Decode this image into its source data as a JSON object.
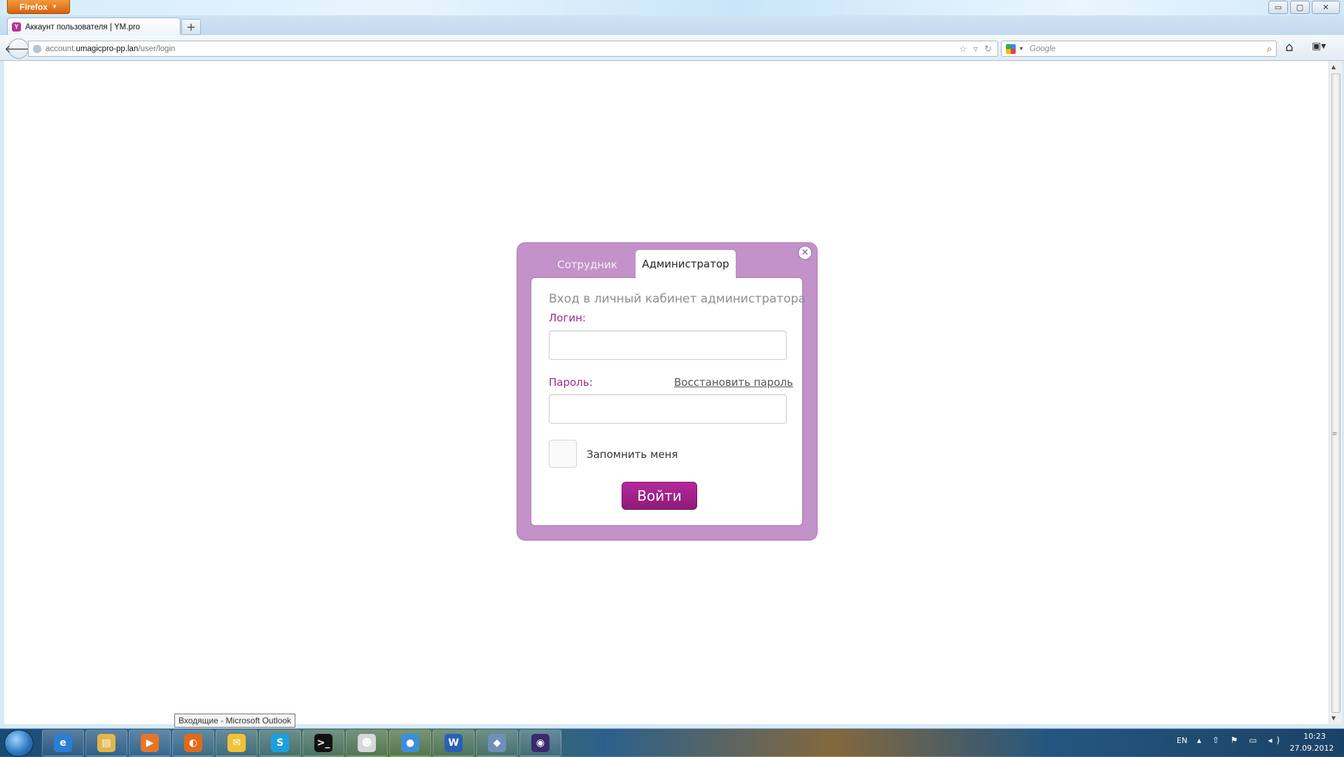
{
  "window": {
    "app_menu": "Firefox",
    "controls": {
      "minimize": "▭",
      "maximize": "▢",
      "close": "✕"
    }
  },
  "browser": {
    "tab_title": "Аккаунт пользователя | YM.pro",
    "new_tab": "+",
    "url_prefix": "account.",
    "url_domain": "umagicpro-pp.lan",
    "url_path": "/user/login",
    "search_placeholder": "Google"
  },
  "dialog": {
    "close_symbol": "×",
    "tabs": {
      "employee": "Сотрудник",
      "admin": "Администратор"
    },
    "heading": "Вход в личный кабинет администратора",
    "login_label": "Логин:",
    "login_value": "",
    "password_label": "Пароль:",
    "password_value": "",
    "restore_link": "Восстановить пароль",
    "remember_label": "Запомнить меня",
    "remember_checked": false,
    "submit": "Войти",
    "colors": {
      "frame": "#c292c8",
      "accent": "#9c2a8c",
      "button": "#a3228b"
    }
  },
  "taskbar": {
    "tooltip": "Входящие - Microsoft Outlook",
    "items": [
      {
        "name": "internet-explorer-icon",
        "glyph": "e",
        "color": "#2a7fd4"
      },
      {
        "name": "explorer-folder-icon",
        "glyph": "▤",
        "color": "#e3b54a"
      },
      {
        "name": "media-player-icon",
        "glyph": "▶",
        "color": "#e3762a"
      },
      {
        "name": "firefox-icon",
        "glyph": "◐",
        "color": "#e06a1c"
      },
      {
        "name": "outlook-icon",
        "glyph": "✉",
        "color": "#f0c23a"
      },
      {
        "name": "skype-icon",
        "glyph": "S",
        "color": "#1aa0e0"
      },
      {
        "name": "terminal-icon",
        "glyph": ">_",
        "color": "#111111"
      },
      {
        "name": "alien-app-icon",
        "glyph": "☻",
        "color": "#d8d8d8"
      },
      {
        "name": "app-blue-icon",
        "glyph": "●",
        "color": "#3c8fd8"
      },
      {
        "name": "word-icon",
        "glyph": "W",
        "color": "#2b5fb3"
      },
      {
        "name": "virtualbox-icon",
        "glyph": "◆",
        "color": "#6e8fb8"
      },
      {
        "name": "eclipse-icon",
        "glyph": "◉",
        "color": "#3a2a6e"
      }
    ],
    "language": "EN",
    "tray_icons": "▴ ⇧ ⚑ ▭ ◂)",
    "time": "10:23",
    "date": "27.09.2012"
  }
}
